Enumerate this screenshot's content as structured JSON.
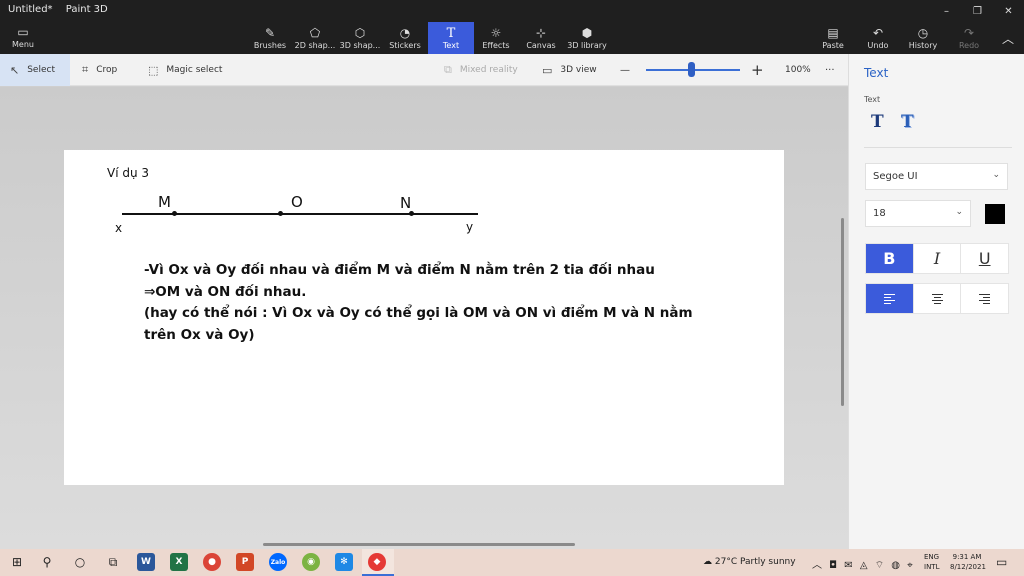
{
  "window": {
    "doc_title": "Untitled*",
    "app_name": "Paint 3D",
    "minimize": "–",
    "restore": "❐",
    "close": "✕"
  },
  "ribbon": {
    "menu_label": "Menu",
    "tools": [
      {
        "label": "Brushes",
        "icon": "✎"
      },
      {
        "label": "2D shap...",
        "icon": "⬠"
      },
      {
        "label": "3D shap...",
        "icon": "⬡"
      },
      {
        "label": "Stickers",
        "icon": "◔"
      },
      {
        "label": "Text",
        "icon": "T"
      },
      {
        "label": "Effects",
        "icon": "☼"
      },
      {
        "label": "Canvas",
        "icon": "⊹"
      },
      {
        "label": "3D library",
        "icon": "⬢"
      }
    ],
    "paste": "Paste",
    "undo": "Undo",
    "history": "History",
    "redo": "Redo",
    "paste_icon": "📋",
    "undo_icon": "↶",
    "history_icon": "◷",
    "redo_icon": "↷",
    "collapse_icon": "︿"
  },
  "toolbar": {
    "select": "Select",
    "crop": "Crop",
    "magic_select": "Magic select",
    "mixed_reality": "Mixed reality",
    "view_3d": "3D view",
    "zoom_out": "—",
    "zoom_in": "+",
    "zoom": "100%",
    "more": "···",
    "zoom_fraction": 0.48
  },
  "canvas": {
    "example_title": "Ví dụ 3",
    "points": {
      "M": "M",
      "O": "O",
      "N": "N",
      "x": "x",
      "y": "y"
    },
    "lines": [
      "-Vì Ox và Oy đối nhau và điểm M và điểm N nằm trên 2 tia đối nhau",
      "⇒OM và ON đối nhau.",
      "(hay có thể nói : Vì Ox và Oy có thể gọi là OM và ON vì điểm M và N nằm",
      "trên Ox và Oy)"
    ]
  },
  "panel": {
    "title": "Text",
    "section": "Text",
    "icon_plain": "T",
    "icon_3d": "T",
    "font": "Segoe UI",
    "size": "18",
    "chevron": "⌄",
    "bold": "B",
    "italic": "I",
    "underline": "U",
    "text_color": "#000000"
  },
  "taskbar": {
    "start_icon": "⊞",
    "search_icon": "⚲",
    "cortana_icon": "○",
    "taskview_icon": "⧉",
    "apps": [
      {
        "label": "W",
        "color": "#2b579a"
      },
      {
        "label": "X",
        "color": "#217346"
      },
      {
        "label": "●",
        "color": "#db4437"
      },
      {
        "label": "P",
        "color": "#d24726"
      },
      {
        "label": "Zalo",
        "color": "#0068ff"
      },
      {
        "label": "◉",
        "color": "#7cb342"
      },
      {
        "label": "✻",
        "color": "#1e88e5"
      },
      {
        "label": "◆",
        "color": "#e53935"
      }
    ],
    "weather": "27°C  Partly sunny",
    "lang_top": "ENG",
    "lang_bottom": "INTL",
    "time": "9:31 AM",
    "date": "8/12/2021",
    "tray": "︿ ◘ ✉ ◬ ⌔ ◍ ⌖"
  }
}
